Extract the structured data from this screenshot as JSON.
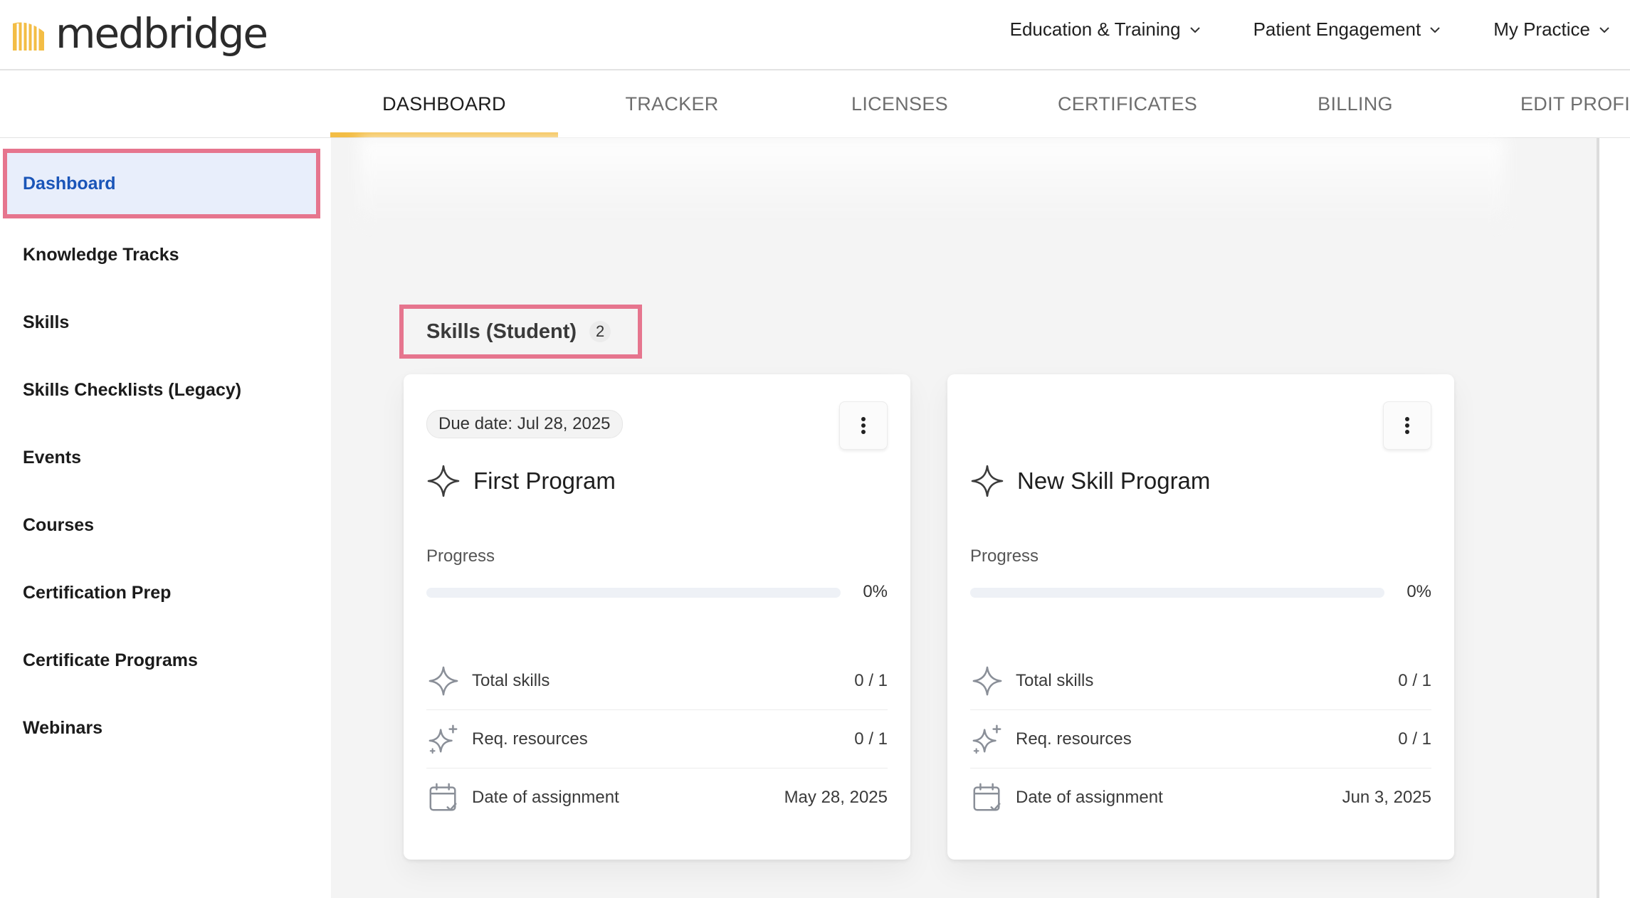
{
  "brand": {
    "name": "medbridge",
    "accent": "#f3bd45",
    "highlight": "#e6758e",
    "link": "#1a55b8"
  },
  "topnav": [
    {
      "label": "Education & Training"
    },
    {
      "label": "Patient Engagement"
    },
    {
      "label": "My Practice"
    }
  ],
  "tabs": [
    {
      "label": "DASHBOARD",
      "active": true
    },
    {
      "label": "TRACKER"
    },
    {
      "label": "LICENSES"
    },
    {
      "label": "CERTIFICATES"
    },
    {
      "label": "BILLING"
    },
    {
      "label": "EDIT PROFIL"
    }
  ],
  "sidebar": {
    "items": [
      {
        "label": "Dashboard",
        "active": true
      },
      {
        "label": "Knowledge Tracks"
      },
      {
        "label": "Skills"
      },
      {
        "label": "Skills Checklists (Legacy)"
      },
      {
        "label": "Events"
      },
      {
        "label": "Courses"
      },
      {
        "label": "Certification Prep"
      },
      {
        "label": "Certificate Programs"
      },
      {
        "label": "Webinars"
      }
    ]
  },
  "section": {
    "title": "Skills (Student)",
    "count": "2"
  },
  "cards": [
    {
      "due": "Due date: Jul 28, 2025",
      "title": "First Program",
      "progress_label": "Progress",
      "progress_percent": 0,
      "progress_text": "0%",
      "stats": [
        {
          "label": "Total skills",
          "value": "0 / 1",
          "icon": "sparkle-icon"
        },
        {
          "label": "Req. resources",
          "value": "0 / 1",
          "icon": "sparkles-icon"
        },
        {
          "label": "Date of assignment",
          "value": "May 28, 2025",
          "icon": "calendar-check-icon"
        }
      ]
    },
    {
      "due": "",
      "title": "New Skill Program",
      "progress_label": "Progress",
      "progress_percent": 0,
      "progress_text": "0%",
      "stats": [
        {
          "label": "Total skills",
          "value": "0 / 1",
          "icon": "sparkle-icon"
        },
        {
          "label": "Req. resources",
          "value": "0 / 1",
          "icon": "sparkles-icon"
        },
        {
          "label": "Date of assignment",
          "value": "Jun 3, 2025",
          "icon": "calendar-check-icon"
        }
      ]
    }
  ]
}
